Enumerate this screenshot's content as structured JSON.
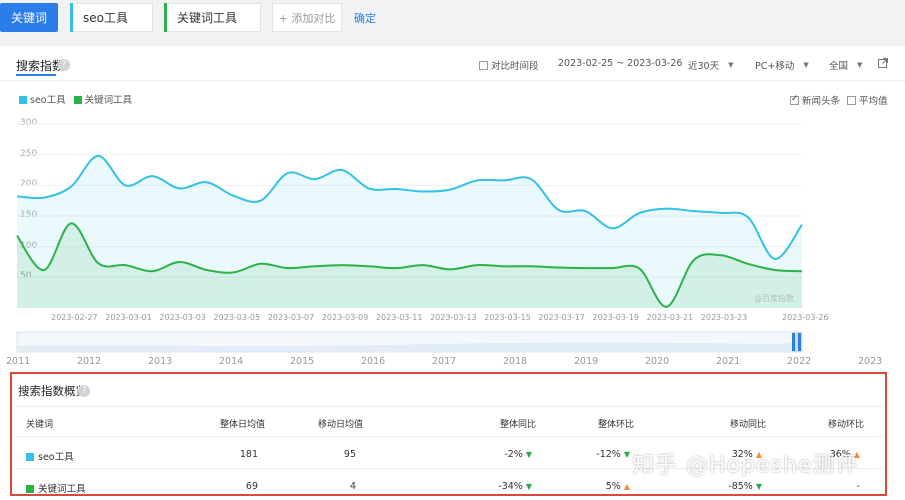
{
  "topbar": {
    "keyword_tab": "关键词",
    "keywords": [
      {
        "label": "seo工具",
        "color": "#33c1e6"
      },
      {
        "label": "关键词工具",
        "color": "#2db24a"
      }
    ],
    "add_compare": "+ 添加对比",
    "confirm": "确定"
  },
  "header": {
    "title": "搜索指数",
    "help": "?",
    "compare_period": "对比时间段",
    "date_range": "2023-02-25 ~ 2023-03-26",
    "period_select": "近30天",
    "device_select": "PC+移动",
    "region_select": "全国"
  },
  "chart_options": {
    "news_headlines": "新闻头条",
    "average": "平均值"
  },
  "legend": [
    {
      "label": "seo工具",
      "color": "#33c1e6"
    },
    {
      "label": "关键词工具",
      "color": "#2db24a"
    }
  ],
  "chart_data": {
    "type": "area",
    "ylim": [
      0,
      300
    ],
    "yticks": [
      "300",
      "250",
      "200",
      "150",
      "100",
      "50"
    ],
    "x_ticks": [
      "2023-02-27",
      "2023-03-01",
      "2023-03-03",
      "2023-03-05",
      "2023-03-07",
      "2023-03-09",
      "2023-03-11",
      "2023-03-13",
      "2023-03-15",
      "2023-03-17",
      "2023-03-19",
      "2023-03-21",
      "2023-03-23",
      "2023-03-26"
    ],
    "x": [
      "02-25",
      "02-26",
      "02-27",
      "02-28",
      "03-01",
      "03-02",
      "03-03",
      "03-04",
      "03-05",
      "03-06",
      "03-07",
      "03-08",
      "03-09",
      "03-10",
      "03-11",
      "03-12",
      "03-13",
      "03-14",
      "03-15",
      "03-16",
      "03-17",
      "03-18",
      "03-19",
      "03-20",
      "03-21",
      "03-22",
      "03-23",
      "03-24",
      "03-25",
      "03-26"
    ],
    "series": [
      {
        "name": "seo工具",
        "color": "#33c1e6",
        "values": [
          182,
          180,
          198,
          248,
          200,
          215,
          195,
          205,
          183,
          175,
          220,
          210,
          225,
          195,
          194,
          190,
          193,
          208,
          208,
          210,
          160,
          158,
          130,
          155,
          162,
          158,
          155,
          148,
          80,
          136
        ]
      },
      {
        "name": "关键词工具",
        "color": "#2db24a",
        "values": [
          118,
          62,
          138,
          73,
          70,
          60,
          75,
          62,
          58,
          72,
          65,
          68,
          70,
          68,
          65,
          70,
          63,
          70,
          68,
          68,
          66,
          65,
          65,
          64,
          2,
          78,
          86,
          72,
          62,
          60
        ]
      }
    ],
    "watermark": "@百度指数"
  },
  "timeline": {
    "years": [
      "2011",
      "2012",
      "2013",
      "2014",
      "2015",
      "2016",
      "2017",
      "2018",
      "2019",
      "2020",
      "2021",
      "2022",
      "2023"
    ]
  },
  "overview": {
    "title": "搜索指数概览",
    "columns": [
      "关键词",
      "整体日均值",
      "移动日均值",
      "整体同比",
      "整体环比",
      "移动同比",
      "移动环比"
    ],
    "rows": [
      {
        "keyword": "seo工具",
        "color": "#33c1e6",
        "overall_avg": "181",
        "mobile_avg": "95",
        "overall_yoy": "-2%",
        "overall_yoy_dir": "down",
        "overall_mom": "-12%",
        "overall_mom_dir": "down",
        "mobile_yoy": "32%",
        "mobile_yoy_dir": "up",
        "mobile_mom": "36%",
        "mobile_mom_dir": "up"
      },
      {
        "keyword": "关键词工具",
        "color": "#2db24a",
        "overall_avg": "69",
        "mobile_avg": "4",
        "overall_yoy": "-34%",
        "overall_yoy_dir": "down",
        "overall_mom": "5%",
        "overall_mom_dir": "up",
        "mobile_yoy": "-85%",
        "mobile_yoy_dir": "down",
        "mobile_mom": "-",
        "mobile_mom_dir": ""
      }
    ]
  },
  "watermark_text": "知乎 @Hopeshe测评"
}
